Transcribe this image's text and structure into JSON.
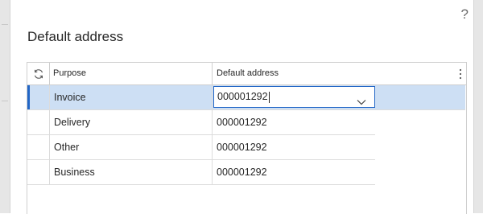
{
  "dialog": {
    "title": "Default address",
    "help_label": "?"
  },
  "grid": {
    "columns": [
      {
        "key": "purpose",
        "label": "Purpose"
      },
      {
        "key": "default_address",
        "label": "Default address"
      }
    ],
    "rows": [
      {
        "purpose": "Invoice",
        "default_address": "000001292",
        "selected": true
      },
      {
        "purpose": "Delivery",
        "default_address": "000001292"
      },
      {
        "purpose": "Other",
        "default_address": "000001292"
      },
      {
        "purpose": "Business",
        "default_address": "000001292"
      }
    ],
    "refresh_icon": "refresh-icon",
    "more_icon": "more-vertical-icon",
    "dropdown_icon": "chevron-down-icon"
  },
  "colors": {
    "accent": "#2266c6",
    "selected_row": "#cddff4"
  }
}
